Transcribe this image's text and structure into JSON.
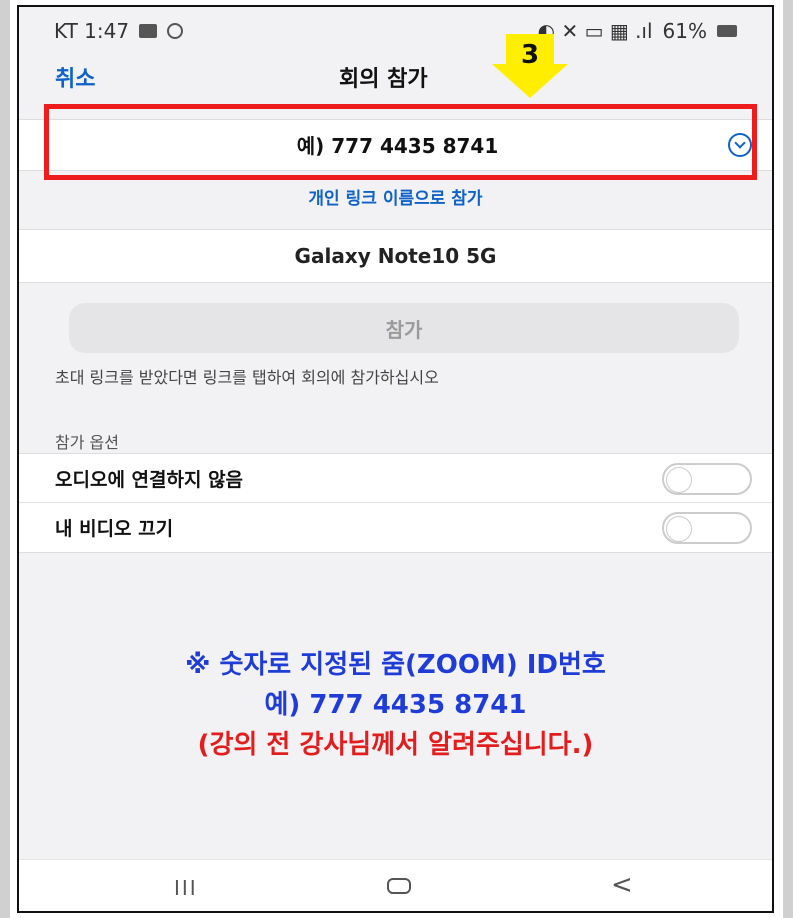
{
  "status_bar": {
    "carrier_time": "KT 1:47",
    "right_text": "61%"
  },
  "header": {
    "cancel_label": "취소",
    "title": "회의 참가"
  },
  "step_badge": "3",
  "meeting_input": {
    "placeholder": "예) 777 4435 8741"
  },
  "personal_link_label": "개인 링크 이름으로 참가",
  "device_name": "Galaxy Note10 5G",
  "join_button_label": "참가",
  "invite_hint": "초대 링크를 받았다면 링크를 탭하여 회의에 참가하십시오",
  "options": {
    "header": "참가 옵션",
    "items": [
      {
        "label": "오디오에 연결하지 않음",
        "enabled": false
      },
      {
        "label": "내 비디오 끄기",
        "enabled": false
      }
    ]
  },
  "annotation": {
    "line1": "※ 숫자로 지정된 줌(ZOOM) ID번호",
    "line2": "예) 777 4435 8741",
    "line3": "(강의 전 강사님께서 알려주십니다.)"
  },
  "nav_bar": {
    "recents": "III",
    "back": "<"
  },
  "colors": {
    "accent_blue": "#0e62c8",
    "highlight_red": "#ee1c1c",
    "arrow_yellow": "#ffee00",
    "annotation_blue": "#1f3cd6",
    "annotation_red": "#e31d1d"
  }
}
